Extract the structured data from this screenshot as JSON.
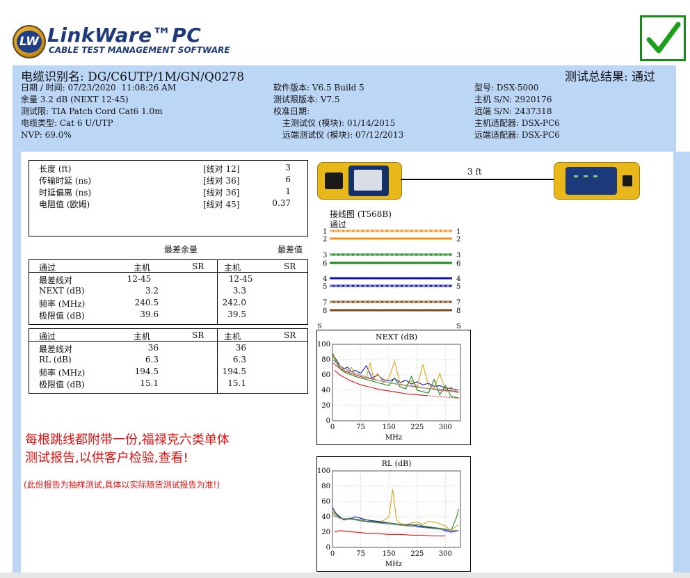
{
  "header": {
    "logo_badge": "LW",
    "logo_title": "LinkWare™PC",
    "logo_subtitle": "CABLE TEST MANAGEMENT SOFTWARE"
  },
  "summary": {
    "cable_id": "电缆识别名: DG/C6UTP/1M/GN/Q0278",
    "result": "测试总结果: 通过",
    "left": [
      "日期 / 时间: 07/23/2020  11:08:26 AM",
      "余量 3.2 dB (NEXT 12-45)",
      "测试限: TIA Patch Cord Cat6 1.0m",
      "电缆类型: Cat 6 U/UTP",
      "NVP: 69.0%"
    ],
    "middle": [
      "软件版本: V6.5 Build 5",
      "测试限版本: V7.5",
      "校准日期:",
      "主测试仪 (模块): 01/14/2015",
      "远端测试仪 (模块): 07/12/2013"
    ],
    "right": [
      "型号: DSX-5000",
      "主机 S/N: 2920176",
      "远端 S/N: 2437318",
      "主机适配器: DSX-PC6",
      "远端适配器: DSX-PC6"
    ]
  },
  "length_table": [
    {
      "label": "长度 (ft)",
      "pair": "[线对 12]",
      "value": "3"
    },
    {
      "label": "传输时延 (ns)",
      "pair": "[线对 36]",
      "value": "6"
    },
    {
      "label": "时延偏离 (ns)",
      "pair": "[线对 36]",
      "value": "1"
    },
    {
      "label": "电阻值 (欧姆)",
      "pair": "[线对 45]",
      "value": "0.37"
    }
  ],
  "margin_headers": {
    "worst_margin": "最差余量",
    "worst_value": "最差值"
  },
  "next_table": {
    "header": [
      "通过",
      "主机",
      "SR",
      "主机",
      "SR"
    ],
    "rows": [
      {
        "label": "最差线对",
        "c1": "12-45",
        "c3": "12-45"
      },
      {
        "label": "NEXT (dB)",
        "c1": "3.2",
        "c3": "3.3"
      },
      {
        "label": "频率 (MHz)",
        "c1": "240.5",
        "c3": "242.0"
      },
      {
        "label": "极限值 (dB)",
        "c1": "39.6",
        "c3": "39.5"
      }
    ]
  },
  "rl_table": {
    "header": [
      "通过",
      "主机",
      "SR",
      "主机",
      "SR"
    ],
    "rows": [
      {
        "label": "最差线对",
        "c1": "36",
        "c3": "36"
      },
      {
        "label": "RL (dB)",
        "c1": "6.3",
        "c3": "6.3"
      },
      {
        "label": "频率 (MHz)",
        "c1": "194.5",
        "c3": "194.5"
      },
      {
        "label": "极限值 (dB)",
        "c1": "15.1",
        "c3": "15.1"
      }
    ]
  },
  "notes": {
    "line1": "每根跳线都附带一份,福禄克六类单体",
    "line2": "测试报告,以供客户检验,查看!",
    "small": "(此份报告为抽样测试,具体以实际随货测试报告为准!)"
  },
  "link": {
    "length_label": "3 ft"
  },
  "wiremap": {
    "title": "接线图 (T568B)",
    "status": "通过",
    "shield_left": "S",
    "shield_right": "S",
    "pins": [
      {
        "n": "1",
        "color": "#f0901c",
        "dashed": true
      },
      {
        "n": "2",
        "color": "#f0901c",
        "dashed": false
      },
      {
        "n": "3",
        "color": "#1a8a1a",
        "dashed": true
      },
      {
        "n": "6",
        "color": "#1a8a1a",
        "dashed": false
      },
      {
        "n": "4",
        "color": "#1010c8",
        "dashed": false
      },
      {
        "n": "5",
        "color": "#1010c8",
        "dashed": true
      },
      {
        "n": "7",
        "color": "#7a4a1a",
        "dashed": true
      },
      {
        "n": "8",
        "color": "#7a4a1a",
        "dashed": false
      }
    ]
  },
  "chart_data": [
    {
      "type": "line",
      "title": "NEXT (dB)",
      "xlabel": "MHz",
      "ylabel": "",
      "xlim": [
        0,
        340
      ],
      "ylim": [
        0,
        100
      ],
      "xticks": [
        0,
        75,
        150,
        225,
        300
      ],
      "yticks": [
        0,
        20,
        40,
        60,
        80,
        100
      ],
      "grid": true,
      "series": [
        {
          "color": "#1010c8",
          "dashed": false,
          "x": [
            0,
            10,
            20,
            30,
            40,
            50,
            60,
            75,
            90,
            105,
            120,
            135,
            150,
            165,
            180,
            195,
            210,
            225,
            240,
            255,
            270,
            285,
            300,
            315,
            335
          ],
          "y": [
            88,
            80,
            72,
            68,
            70,
            64,
            66,
            62,
            72,
            56,
            60,
            54,
            52,
            55,
            50,
            53,
            48,
            51,
            47,
            49,
            45,
            46,
            43,
            42,
            40
          ]
        },
        {
          "color": "#e0a010",
          "dashed": false,
          "x": [
            0,
            10,
            20,
            30,
            40,
            50,
            60,
            75,
            90,
            100,
            110,
            120,
            135,
            150,
            165,
            180,
            195,
            210,
            225,
            240,
            255,
            270,
            285,
            300,
            315,
            335
          ],
          "y": [
            90,
            78,
            70,
            66,
            62,
            70,
            60,
            58,
            56,
            76,
            54,
            62,
            50,
            56,
            78,
            48,
            46,
            52,
            44,
            74,
            46,
            42,
            62,
            40,
            44,
            36
          ]
        },
        {
          "color": "#1a8a1a",
          "dashed": false,
          "x": [
            0,
            10,
            20,
            30,
            40,
            50,
            60,
            75,
            90,
            105,
            120,
            135,
            150,
            165,
            180,
            195,
            210,
            225,
            240,
            255,
            270,
            285,
            300,
            315,
            335
          ],
          "y": [
            86,
            76,
            68,
            64,
            62,
            60,
            58,
            56,
            54,
            52,
            50,
            48,
            46,
            56,
            44,
            42,
            58,
            40,
            38,
            36,
            54,
            34,
            46,
            32,
            30
          ]
        },
        {
          "color": "#c04050",
          "dashed": false,
          "x": [
            0,
            20,
            40,
            60,
            80,
            100,
            120,
            140,
            160,
            180,
            200,
            220,
            240,
            260,
            280,
            300,
            320,
            335
          ],
          "y": [
            76,
            68,
            64,
            60,
            57,
            55,
            53,
            51,
            49,
            47,
            46,
            45,
            43,
            42,
            41,
            40,
            39,
            38
          ]
        },
        {
          "color": "#909090",
          "dashed": false,
          "x": [
            0,
            20,
            40,
            60,
            80,
            100,
            120,
            140,
            160,
            180,
            200,
            220,
            240,
            260,
            280,
            300,
            320,
            335
          ],
          "y": [
            80,
            72,
            66,
            62,
            59,
            56,
            53,
            51,
            49,
            47,
            46,
            44,
            43,
            42,
            40,
            39,
            38,
            37
          ]
        },
        {
          "color": "#e01010",
          "dashed": false,
          "x": [
            5,
            10,
            20,
            30,
            45,
            60,
            75,
            100,
            125,
            150,
            175,
            200,
            225,
            250
          ],
          "y": [
            66,
            64,
            60,
            57,
            53,
            50,
            47,
            44,
            41,
            39,
            37,
            35,
            34,
            33
          ]
        },
        {
          "color": "#e01010",
          "dashed": true,
          "x": [
            250,
            275,
            300,
            325,
            340
          ],
          "y": [
            33,
            32,
            31,
            30,
            29
          ]
        }
      ]
    },
    {
      "type": "line",
      "title": "RL (dB)",
      "xlabel": "MHz",
      "ylabel": "",
      "xlim": [
        0,
        340
      ],
      "ylim": [
        0,
        100
      ],
      "xticks": [
        0,
        75,
        150,
        225,
        300
      ],
      "yticks": [
        0,
        20,
        40,
        60,
        80,
        100
      ],
      "grid": true,
      "series": [
        {
          "color": "#e0a010",
          "dashed": false,
          "x": [
            0,
            10,
            20,
            30,
            45,
            60,
            75,
            90,
            105,
            120,
            135,
            150,
            160,
            170,
            180,
            195,
            210,
            225,
            240,
            255,
            270,
            285,
            300,
            315,
            335
          ],
          "y": [
            48,
            44,
            38,
            36,
            38,
            36,
            35,
            36,
            34,
            33,
            35,
            40,
            76,
            36,
            31,
            30,
            32,
            33,
            30,
            34,
            33,
            31,
            28,
            22,
            30
          ]
        },
        {
          "color": "#1010c8",
          "dashed": false,
          "x": [
            0,
            10,
            20,
            30,
            45,
            60,
            75,
            90,
            105,
            120,
            135,
            150,
            165,
            180,
            195,
            210,
            225,
            240,
            255,
            270,
            285,
            300,
            315,
            335
          ],
          "y": [
            52,
            44,
            40,
            36,
            37,
            40,
            38,
            36,
            35,
            34,
            33,
            32,
            31,
            30,
            29,
            30,
            28,
            27,
            26,
            25,
            24,
            22,
            20,
            22
          ]
        },
        {
          "color": "#1a8a1a",
          "dashed": false,
          "x": [
            0,
            10,
            20,
            30,
            45,
            60,
            75,
            90,
            105,
            120,
            135,
            150,
            165,
            180,
            195,
            210,
            225,
            240,
            255,
            270,
            285,
            300,
            315,
            330,
            335
          ],
          "y": [
            46,
            42,
            39,
            37,
            38,
            37,
            36,
            34,
            34,
            33,
            32,
            32,
            31,
            30,
            29,
            28,
            30,
            28,
            27,
            26,
            25,
            24,
            22,
            40,
            50
          ]
        },
        {
          "color": "#808080",
          "dashed": false,
          "x": [
            0,
            20,
            40,
            60,
            80,
            100,
            120,
            140,
            160,
            180,
            200,
            220,
            240,
            260,
            280,
            300,
            320,
            335
          ],
          "y": [
            42,
            38,
            37,
            36,
            34,
            33,
            32,
            31,
            30,
            29,
            28,
            27,
            26,
            25,
            24,
            23,
            22,
            22
          ]
        },
        {
          "color": "#e01010",
          "dashed": false,
          "x": [
            5,
            20,
            40,
            60,
            80,
            100,
            120,
            150,
            180,
            210,
            240,
            270,
            300
          ],
          "y": [
            20,
            22,
            21,
            20,
            19,
            18,
            18,
            17,
            17,
            16,
            16,
            15,
            15
          ]
        }
      ]
    }
  ]
}
